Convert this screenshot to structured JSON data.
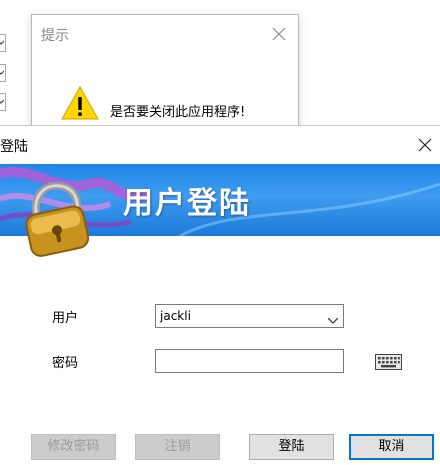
{
  "prompt_dialog": {
    "title": "提示",
    "message": "是否要关闭此应用程序!"
  },
  "login_window": {
    "title": "登陆",
    "banner_title": "用户登陆",
    "user_label": "用户",
    "user_value": "jackli",
    "password_label": "密码",
    "password_value": ""
  },
  "buttons": {
    "change_password": "修改密码",
    "logout": "注销",
    "login": "登陆",
    "cancel": "取消"
  },
  "colors": {
    "banner_blue": "#2a8cea",
    "primary_border": "#0078d7",
    "warning_yellow": "#ffd500"
  },
  "icons": {
    "prompt_close": "close-icon",
    "warning": "warning-icon",
    "lock": "padlock-icon",
    "keyboard": "keyboard-icon",
    "dropdown": "chevron-down-icon"
  }
}
